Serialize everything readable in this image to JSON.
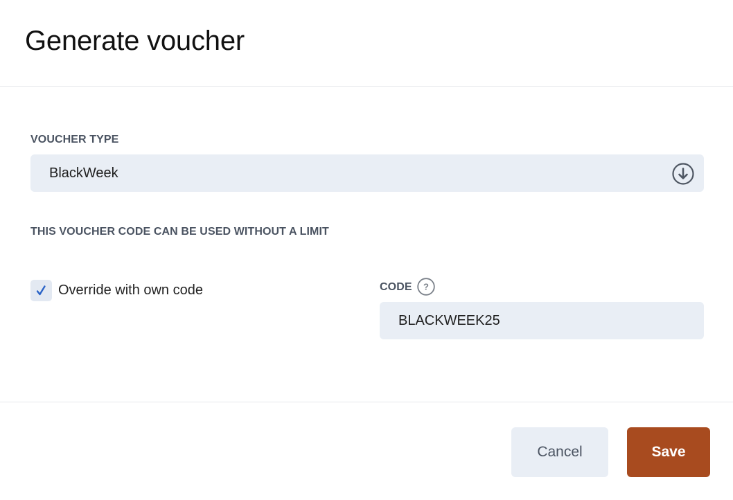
{
  "dialog": {
    "title": "Generate voucher"
  },
  "voucher_type": {
    "label": "VOUCHER TYPE",
    "selected": "BlackWeek",
    "arrow_icon": "arrow-down-circle-icon"
  },
  "info": {
    "text": "THIS VOUCHER CODE CAN BE USED WITHOUT A LIMIT"
  },
  "override": {
    "label": "Override with own code",
    "checked": true,
    "check_icon": "checkmark-icon"
  },
  "code": {
    "label": "CODE",
    "help_icon": "question-circle-icon",
    "value": "BLACKWEEK25"
  },
  "footer": {
    "cancel_label": "Cancel",
    "save_label": "Save"
  },
  "colors": {
    "accent": "#a84b1f",
    "field_bg": "#e9eef5",
    "label_text": "#4a5361",
    "checkmark": "#2a63c7"
  }
}
